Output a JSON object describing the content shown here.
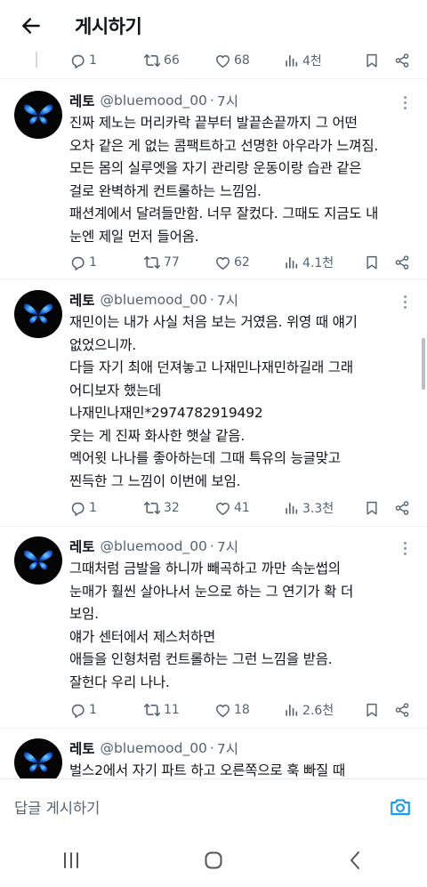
{
  "header": {
    "title": "게시하기",
    "back_icon": "arrow-left-icon"
  },
  "top_actions": {
    "replies": "1",
    "retweets": "66",
    "likes": "68",
    "views": "4천"
  },
  "tweets": [
    {
      "author": "레토",
      "handle": "@bluemood_00",
      "time": "7시",
      "lines": [
        "진짜 제노는 머리카락 끝부터 발끝손끝까지 그 어떤",
        "오차 같은 게 없는 콤팩트하고 선명한 아우라가 느껴짐.",
        "모든 몸의 실루엣을 자기 관리랑 운동이랑 습관 같은",
        "걸로 완벽하게 컨트롤하는 느낌임.",
        "패션계에서 달려들만함. 너무 잘컸다. 그때도 지금도 내",
        "눈엔 제일 먼저 들어옴."
      ],
      "replies": "1",
      "retweets": "77",
      "likes": "62",
      "views": "4.1천"
    },
    {
      "author": "레토",
      "handle": "@bluemood_00",
      "time": "7시",
      "lines": [
        "재민이는 내가 사실 처음 보는 거였음. 위영 때 얘기",
        "없었으니까.",
        "다들 자기 최애 던져놓고 나재민나재민하길래 그래",
        "어디보자 했는데",
        "나재민나재민*2974782919492",
        "웃는 게 진짜 화사한 햇살 같음.",
        "멕어윗 나나를 좋아하는데 그때 특유의 능글맞고",
        "찐득한 그 느낌이 이번에 보임."
      ],
      "replies": "1",
      "retweets": "32",
      "likes": "41",
      "views": "3.3천"
    },
    {
      "author": "레토",
      "handle": "@bluemood_00",
      "time": "7시",
      "lines": [
        "그때처럼 금발을 하니까 빼곡하고 까만 속눈썹의",
        "눈매가 훨씬 살아나서 눈으로 하는 그 연기가 확 더",
        "보임.",
        "얘가 센터에서 제스처하면",
        "애들을 인형처럼 컨트롤하는 그런 느낌을 받음.",
        "잘헌다 우리 나나."
      ],
      "replies": "1",
      "retweets": "11",
      "likes": "18",
      "views": "2.6천"
    },
    {
      "author": "레토",
      "handle": "@bluemood_00",
      "time": "7시",
      "lines": [
        "벌스2에서 자기 파트 하고 오른쪽으로 훅 빠질 때"
      ]
    }
  ],
  "reply_bar": {
    "placeholder": "답글 게시하기",
    "camera_icon": "camera-icon"
  },
  "nav": {
    "recent_icon": "recent-apps-icon",
    "home_icon": "home-icon",
    "back_icon": "nav-back-icon"
  },
  "colors": {
    "text": "#0f1419",
    "secondary": "#536471",
    "accent": "#1d9bf0",
    "divider": "#eff3f4"
  }
}
